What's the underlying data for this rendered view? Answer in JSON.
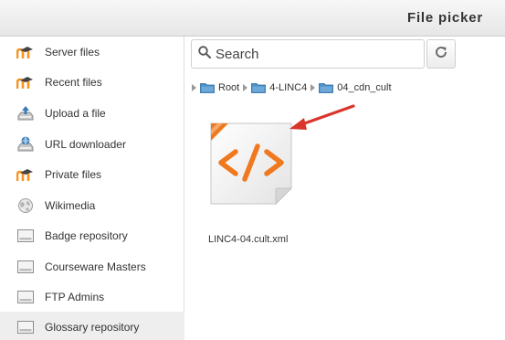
{
  "window": {
    "title": "File picker"
  },
  "sidebar": {
    "items": [
      {
        "label": "Server files",
        "icon": "moodle-icon",
        "active": false
      },
      {
        "label": "Recent files",
        "icon": "moodle-icon",
        "active": false
      },
      {
        "label": "Upload a file",
        "icon": "upload-icon",
        "active": false
      },
      {
        "label": "URL downloader",
        "icon": "url-downloader-icon",
        "active": false
      },
      {
        "label": "Private files",
        "icon": "moodle-icon",
        "active": false
      },
      {
        "label": "Wikimedia",
        "icon": "wikimedia-globe-icon",
        "active": false
      },
      {
        "label": "Badge repository",
        "icon": "repository-icon",
        "active": false
      },
      {
        "label": "Courseware Masters",
        "icon": "repository-icon",
        "active": false
      },
      {
        "label": "FTP Admins",
        "icon": "repository-icon",
        "active": false
      },
      {
        "label": "Glossary repository",
        "icon": "repository-icon",
        "active": true
      }
    ]
  },
  "toolbar": {
    "search_placeholder": "Search",
    "search_icon": "search-icon",
    "refresh_icon": "refresh-icon"
  },
  "breadcrumb": {
    "items": [
      {
        "label": "Root"
      },
      {
        "label": "4-LINC4"
      },
      {
        "label": "04_cdn_cult"
      }
    ]
  },
  "files": [
    {
      "name": "LINC4-04.cult.xml",
      "icon": "xml-file-icon"
    }
  ],
  "colors": {
    "moodle_orange": "#f7931e",
    "xml_orange": "#f0781e",
    "arrow_red": "#d9352b",
    "folder_blue": "#4a90c8"
  }
}
